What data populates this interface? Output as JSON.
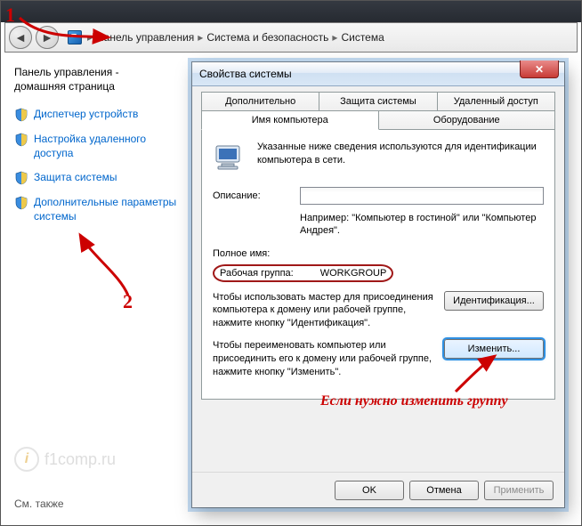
{
  "breadcrumb": {
    "items": [
      "Панель управления",
      "Система и безопасность",
      "Система"
    ]
  },
  "sidebar": {
    "home_line1": "Панель управления -",
    "home_line2": "домашняя страница",
    "links": [
      "Диспетчер устройств",
      "Настройка удаленного доступа",
      "Защита системы",
      "Дополнительные параметры системы"
    ],
    "footer": "См. также"
  },
  "brand": {
    "text": "f1comp.ru",
    "badge": "i"
  },
  "dialog": {
    "title": "Свойства системы",
    "close_glyph": "✕",
    "tabs_row1": [
      "Дополнительно",
      "Защита системы",
      "Удаленный доступ"
    ],
    "tabs_row2": [
      "Имя компьютера",
      "Оборудование"
    ],
    "intro_text": "Указанные ниже сведения используются для идентификации компьютера в сети.",
    "desc_label": "Описание:",
    "desc_value": "",
    "example_text": "Например: \"Компьютер в гостиной\" или \"Компьютер Андрея\".",
    "fullname_label": "Полное имя:",
    "fullname_value": "",
    "workgroup_label": "Рабочая группа:",
    "workgroup_value": "WORKGROUP",
    "ident_text": "Чтобы использовать мастер для присоединения компьютера к домену или рабочей группе, нажмите кнопку \"Идентификация\".",
    "ident_btn": "Идентификация...",
    "change_text": "Чтобы переименовать компьютер или присоединить его к домену или рабочей группе, нажмите кнопку \"Изменить\".",
    "change_btn": "Изменить...",
    "ok": "OK",
    "cancel": "Отмена",
    "apply": "Применить"
  },
  "annotations": {
    "n1": "1",
    "n2": "2",
    "caption": "Если нужно изменить группу"
  }
}
